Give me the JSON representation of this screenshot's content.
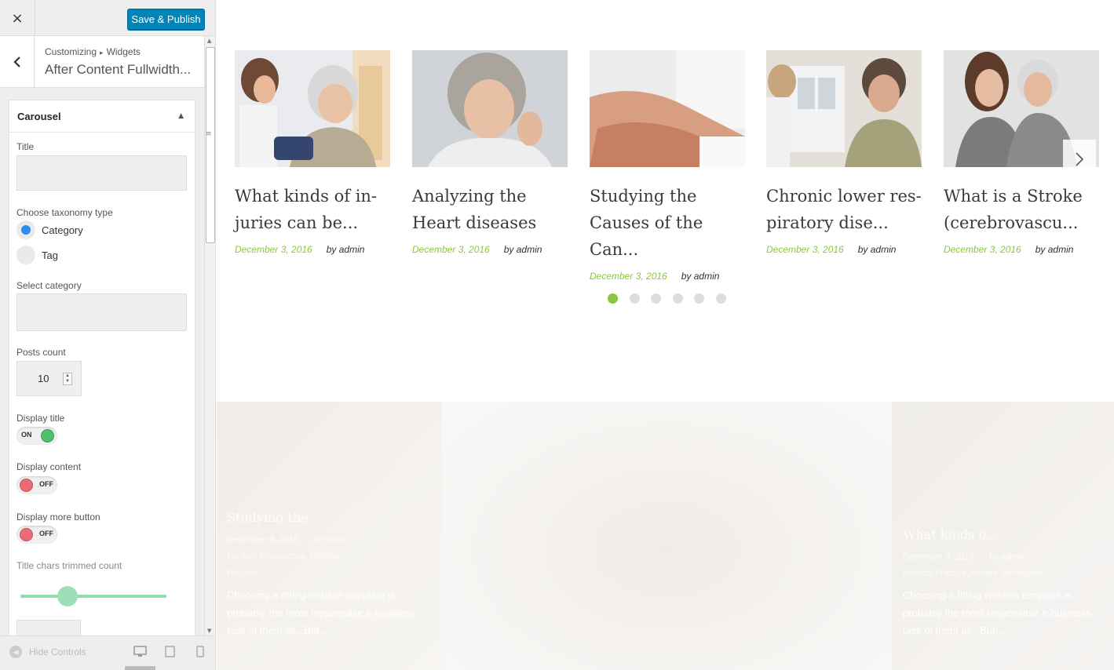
{
  "customizer": {
    "close_icon": "×",
    "save_label": "Save & Publish",
    "back_icon": "‹",
    "breadcrumb": {
      "root": "Customizing",
      "separator": "▸",
      "current": "Widgets"
    },
    "section_title": "After Content Fullwidth...",
    "widget": {
      "title": "Carousel",
      "title_label": "Title",
      "title_value": "",
      "taxonomy_label": "Choose taxonomy type",
      "taxonomy_options": [
        "Category",
        "Tag"
      ],
      "taxonomy_selected": "Category",
      "category_label": "Select category",
      "category_value": "",
      "posts_count_label": "Posts count",
      "posts_count": "10",
      "display_title_label": "Display title",
      "display_title_state": "ON",
      "display_content_label": "Display content",
      "display_content_state": "OFF",
      "display_more_label": "Display more button",
      "display_more_state": "OFF",
      "trim_label": "Title chars trimmed count",
      "trim_slider_level": 0.32
    },
    "footer": {
      "hide_label": "Hide Controls"
    },
    "accent_color": "#0085ba"
  },
  "carousel": {
    "posts": [
      {
        "title": "What kinds of in-juries can be...",
        "date": "December 3, 2016",
        "author": "by admin"
      },
      {
        "title": "Analyzing the Heart diseases",
        "date": "December 3, 2016",
        "author": "by admin"
      },
      {
        "title": "Studying the Causes of the Can...",
        "date": "December 3, 2016",
        "author": "by admin"
      },
      {
        "title": "Chronic lower res-piratory dise...",
        "date": "December 3, 2016",
        "author": "by admin"
      },
      {
        "title": "What is a Stroke (cerebrovascu...",
        "date": "December 3, 2016",
        "author": "by admin"
      }
    ],
    "dots_total": 6,
    "active_dot": 1,
    "accent_color": "#8cc63f"
  },
  "featured": {
    "left": {
      "title": "Studying the...",
      "date": "December 3, 2016",
      "author": "by admin",
      "categories": "Medical Researches, Medical Practice",
      "excerpt": "Choosing a fitting website template is probably the most responsible e-business task of them all...But..."
    },
    "right": {
      "title": "What kinds o...",
      "date": "December 3, 2016",
      "author": "by admin",
      "categories": "Medical Practice, Patient Information",
      "excerpt": "Choosing a fitting website template is probably the most responsible e-business task of them all...But..."
    }
  }
}
